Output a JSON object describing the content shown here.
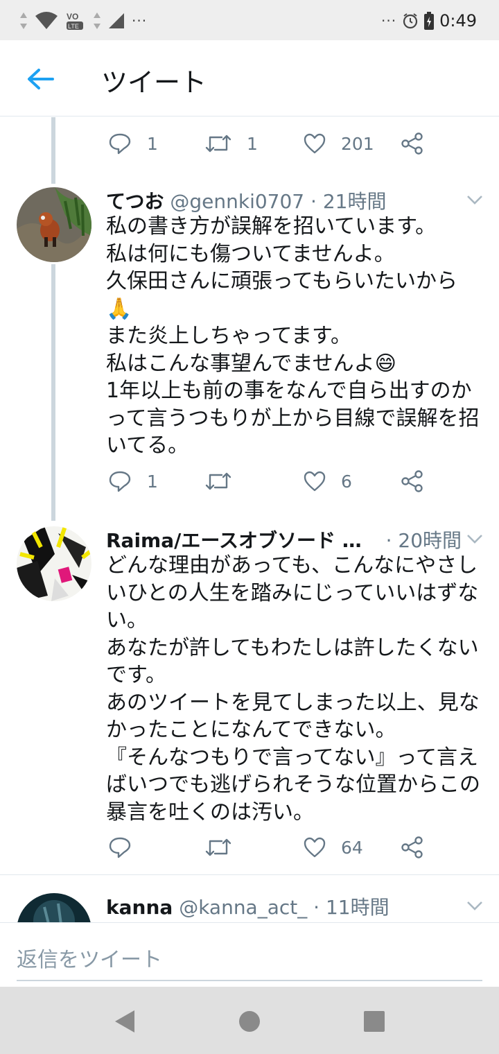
{
  "status_bar": {
    "time": "0:49",
    "dots_left": "···",
    "dots_right": "···",
    "lte_label": "LTE",
    "vo_label": "VO",
    "icons": [
      "signal-updown-icon",
      "wifi-icon",
      "volte-icon",
      "cell-signal-icon",
      "more-icon",
      "alarm-icon",
      "battery-icon"
    ]
  },
  "header": {
    "title": "ツイート"
  },
  "tweets": [
    {
      "reply_count": "1",
      "retweet_count": "1",
      "like_count": "201"
    },
    {
      "name": "てつお",
      "handle": "@gennki0707",
      "time": "· 21時間",
      "text": "私の書き方が誤解を招いています。\n私は何にも傷ついてませんよ。\n久保田さんに頑張ってもらいたいから\n🙏\nまた炎上しちゃってます。\n私はこんな事望んでませんよ😄\n1年以上も前の事をなんで自ら出すのかって言うつもりが上から目線で誤解を招いてる。",
      "reply_count": "1",
      "retweet_count": "",
      "like_count": "6"
    },
    {
      "name": "Raima/エースオブソード …",
      "handle": "",
      "time": "· 20時間",
      "text": "どんな理由があっても、こんなにやさしいひとの人生を踏みにじっていいはずない。\nあなたが許してもわたしは許したくないです。\nあのツイートを見てしまった以上、見なかったことになんてできない。\n『そんなつもりで言ってない』って言えばいつでも逃げられそうな位置からこの暴言を吐くのは汚い。",
      "reply_count": "",
      "retweet_count": "",
      "like_count": "64"
    },
    {
      "name": "kanna",
      "handle": "@kanna_act_",
      "time": "· 11時間"
    }
  ],
  "reply_bar": {
    "placeholder": "返信をツイート"
  },
  "colors": {
    "accent": "#1da1f2",
    "muted": "#657786",
    "divider": "#e1e8ed",
    "thread_line": "#ccd6dd"
  }
}
